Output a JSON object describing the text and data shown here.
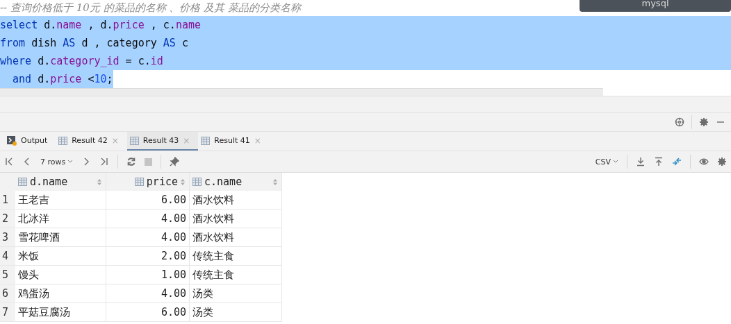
{
  "editor": {
    "comment": "-- 查询价格低于 10元 的菜品的名称 、价格 及其 菜品的分类名称",
    "lines": [
      {
        "selected": true,
        "tokens": [
          {
            "kind": "keyword",
            "text": "select"
          },
          {
            "kind": "plain",
            "text": " d."
          },
          {
            "kind": "field",
            "text": "name"
          },
          {
            "kind": "plain",
            "text": " , d."
          },
          {
            "kind": "field",
            "text": "price"
          },
          {
            "kind": "plain",
            "text": " , c."
          },
          {
            "kind": "field",
            "text": "name"
          }
        ]
      },
      {
        "selected": true,
        "tokens": [
          {
            "kind": "keyword",
            "text": "from"
          },
          {
            "kind": "plain",
            "text": " dish "
          },
          {
            "kind": "keyword",
            "text": "AS"
          },
          {
            "kind": "plain",
            "text": " d , category "
          },
          {
            "kind": "keyword",
            "text": "AS"
          },
          {
            "kind": "plain",
            "text": " c"
          }
        ]
      },
      {
        "selected": true,
        "tokens": [
          {
            "kind": "keyword",
            "text": "where"
          },
          {
            "kind": "plain",
            "text": " d."
          },
          {
            "kind": "field",
            "text": "category_id"
          },
          {
            "kind": "plain",
            "text": " = c."
          },
          {
            "kind": "field",
            "text": "id"
          }
        ]
      },
      {
        "selected": true,
        "tokens": [
          {
            "kind": "keyword",
            "text": "  and"
          },
          {
            "kind": "plain",
            "text": " d."
          },
          {
            "kind": "field",
            "text": "price"
          },
          {
            "kind": "plain",
            "text": " <"
          },
          {
            "kind": "number",
            "text": "10"
          },
          {
            "kind": "plain",
            "text": ";"
          }
        ]
      }
    ]
  },
  "tooltip": "mysql",
  "tabs": [
    {
      "kind": "console",
      "label": "Output",
      "selected": false
    },
    {
      "kind": "table",
      "label": "Result 42",
      "selected": false,
      "close": "×"
    },
    {
      "kind": "table",
      "label": "Result 43",
      "selected": true,
      "close": "×"
    },
    {
      "kind": "table",
      "label": "Result 41",
      "selected": false,
      "close": "×"
    }
  ],
  "toolbar": {
    "rows": "7 rows",
    "format": "CSV"
  },
  "table": {
    "columns": [
      {
        "label": "d.name",
        "kind": "text"
      },
      {
        "label": "price",
        "kind": "number"
      },
      {
        "label": "c.name",
        "kind": "text"
      }
    ],
    "rows": [
      {
        "index": "1",
        "cells": [
          "王老吉",
          "6.00",
          "酒水饮料"
        ]
      },
      {
        "index": "2",
        "cells": [
          "北冰洋",
          "4.00",
          "酒水饮料"
        ]
      },
      {
        "index": "3",
        "cells": [
          "雪花啤酒",
          "4.00",
          "酒水饮料"
        ]
      },
      {
        "index": "4",
        "cells": [
          "米饭",
          "2.00",
          "传统主食"
        ]
      },
      {
        "index": "5",
        "cells": [
          "馒头",
          "1.00",
          "传统主食"
        ]
      },
      {
        "index": "6",
        "cells": [
          "鸡蛋汤",
          "4.00",
          "汤类"
        ]
      },
      {
        "index": "7",
        "cells": [
          "平菇豆腐汤",
          "6.00",
          "汤类"
        ]
      }
    ]
  }
}
